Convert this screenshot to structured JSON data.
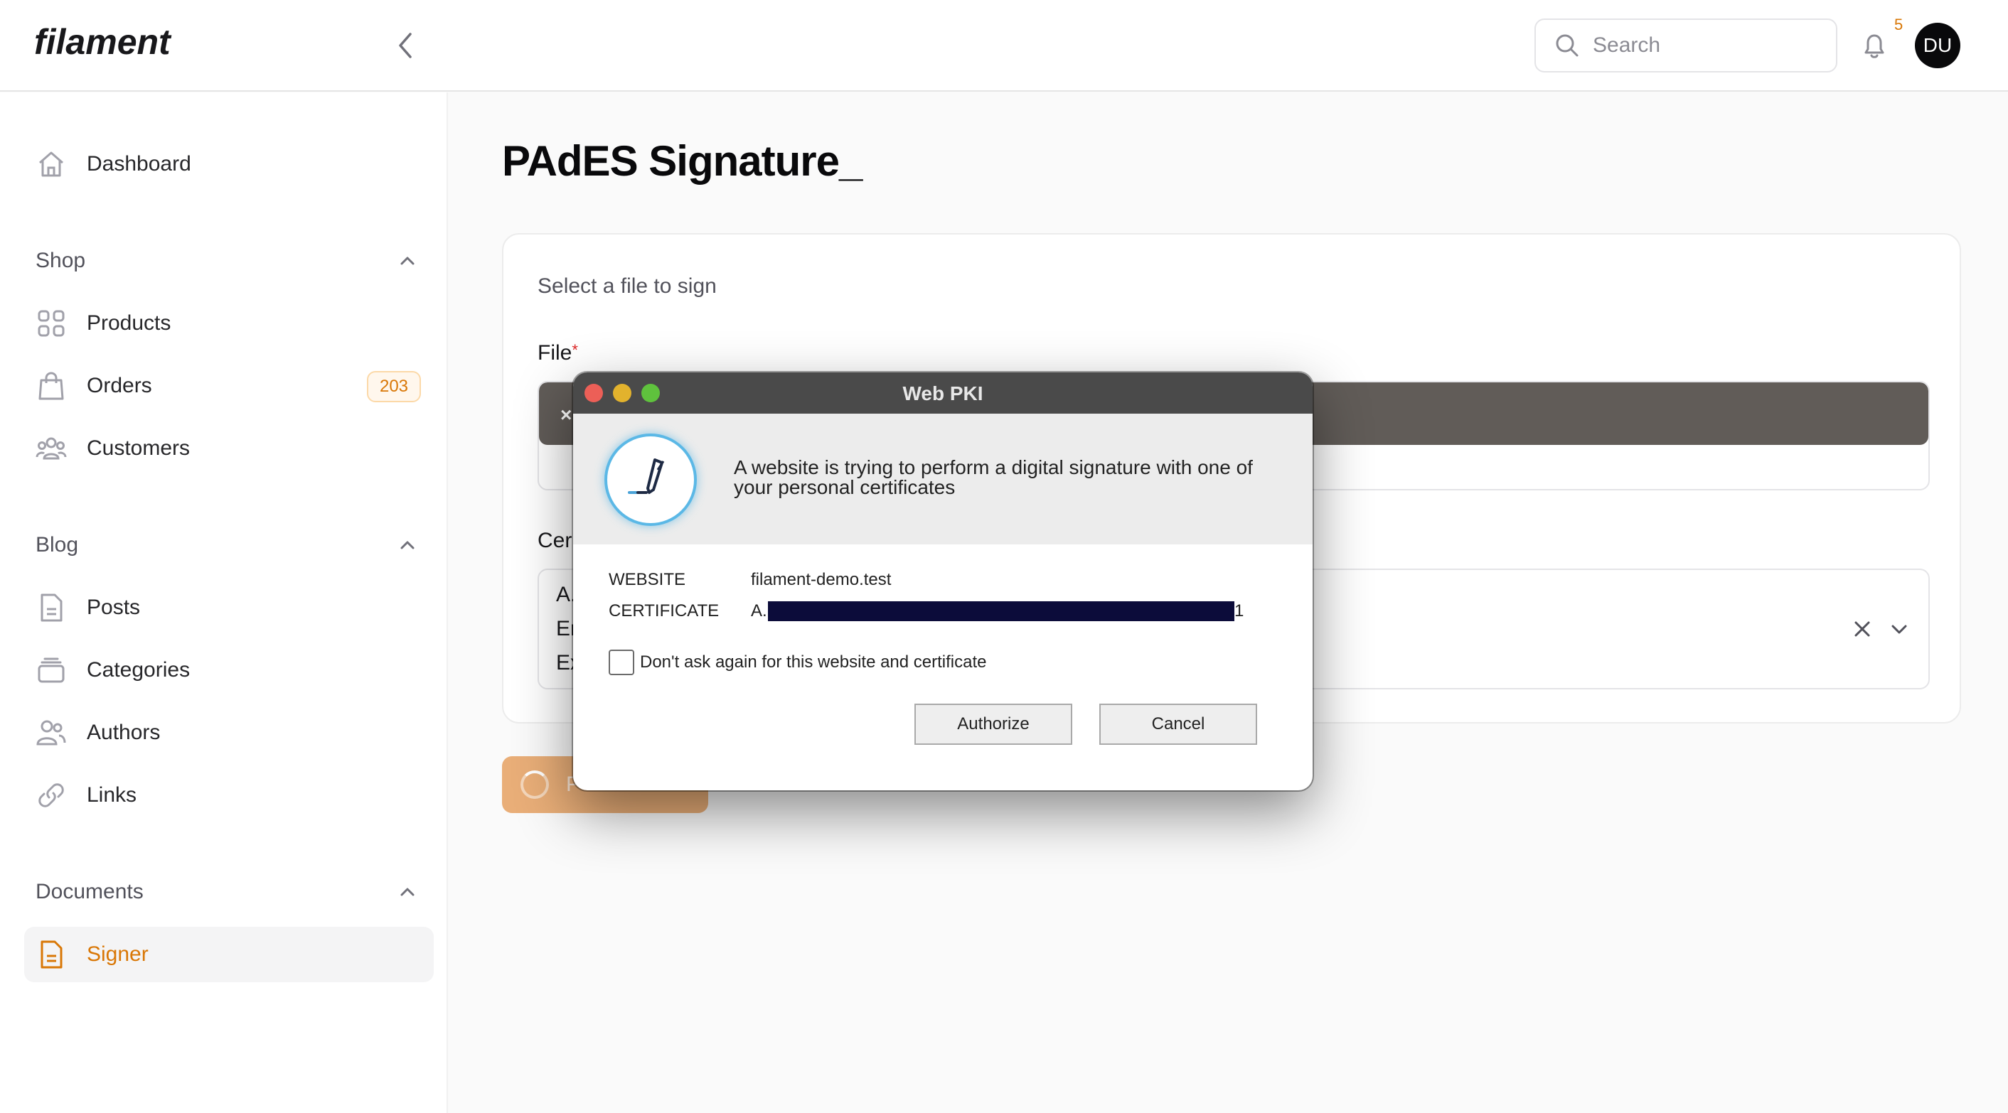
{
  "app": {
    "logo": "filament"
  },
  "topbar": {
    "search_placeholder": "Search",
    "notifications_count": "5",
    "avatar_initials": "DU"
  },
  "sidebar": {
    "dashboard": "Dashboard",
    "groups": [
      {
        "title": "Shop",
        "items": [
          {
            "label": "Products"
          },
          {
            "label": "Orders",
            "badge": "203"
          },
          {
            "label": "Customers"
          }
        ]
      },
      {
        "title": "Blog",
        "items": [
          {
            "label": "Posts"
          },
          {
            "label": "Categories"
          },
          {
            "label": "Authors"
          },
          {
            "label": "Links"
          }
        ]
      },
      {
        "title": "Documents",
        "items": [
          {
            "label": "Signer",
            "active": true
          }
        ]
      }
    ]
  },
  "main": {
    "title": "PAdES Signature_",
    "card_subtitle": "Select a file to sign",
    "file_label": "File",
    "required_mark": "*",
    "file_remove": "×",
    "cert_label": "Cer",
    "cert_lines": [
      "A.",
      "En",
      "Ex"
    ],
    "submit_label": "P"
  },
  "dialog": {
    "window_title": "Web PKI",
    "message": "A website is trying to perform a digital signature with one of your personal certificates",
    "website_key": "WEBSITE",
    "website_value": "filament-demo.test",
    "certificate_key": "CERTIFICATE",
    "certificate_prefix": "A.",
    "certificate_suffix": "1",
    "checkbox_label": "Don't ask again for this website and certificate",
    "authorize_label": "Authorize",
    "cancel_label": "Cancel"
  },
  "colors": {
    "accent": "#d97706",
    "active_bg": "#f4f4f5",
    "dialog_titlebar": "#4a4a4a",
    "redaction": "#0c0c3a"
  }
}
